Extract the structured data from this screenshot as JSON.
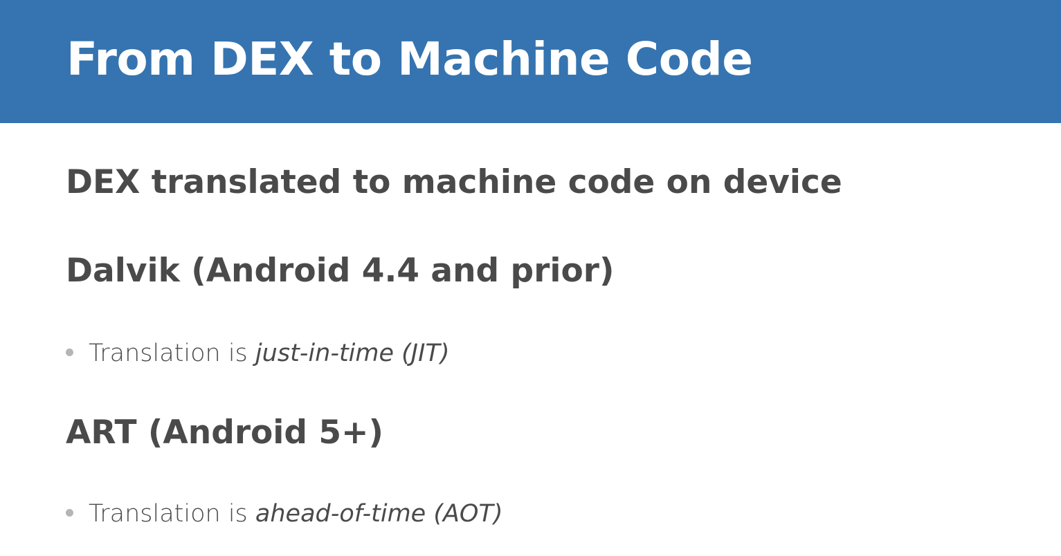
{
  "title": "From DEX to Machine Code",
  "colors": {
    "title_bar": "#3574b0",
    "title_text": "#ffffff",
    "body_text": "#4a4a4a",
    "bullet_dot": "#b5b5b5"
  },
  "items": [
    {
      "heading": "DEX translated to machine code on device"
    },
    {
      "heading": "Dalvik (Android 4.4 and prior)",
      "bullet": {
        "prefix": "Translation is ",
        "emphasis": "just-in-time (JIT)"
      }
    },
    {
      "heading": "ART (Android 5+)",
      "bullet": {
        "prefix": "Translation is ",
        "emphasis": "ahead-of-time (AOT)"
      }
    }
  ],
  "icons": {
    "bullet": "bullet-dot-icon"
  }
}
